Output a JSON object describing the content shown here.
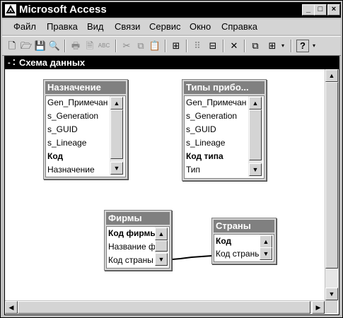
{
  "app": {
    "title": "Microsoft Access"
  },
  "titlebar_buttons": [
    "_",
    "□",
    "×"
  ],
  "menu": [
    "Файл",
    "Правка",
    "Вид",
    "Связи",
    "Сервис",
    "Окно",
    "Справка"
  ],
  "toolbar_icons": {
    "new": "🗋",
    "open": "🗁",
    "save": "💾",
    "print_preview": "🔍",
    "print": "🖶",
    "preview": "🗎",
    "spell": "ABC",
    "cut": "✂",
    "copy": "⧉",
    "paste": "📋",
    "show_table": "⊞",
    "direct_rel": "⠿",
    "all_rel": "⊟",
    "delete": "✕",
    "db_window": "⧉",
    "new_object": "⊞",
    "help": "?"
  },
  "document": {
    "title": "Схема данных",
    "icon": "- ⁚"
  },
  "tables": [
    {
      "title": "Назначение",
      "fields": [
        {
          "name": "Gen_Примечан",
          "key": false
        },
        {
          "name": "s_Generation",
          "key": false
        },
        {
          "name": "s_GUID",
          "key": false
        },
        {
          "name": "s_Lineage",
          "key": false
        },
        {
          "name": "Код",
          "key": true
        },
        {
          "name": "Назначение",
          "key": false
        }
      ]
    },
    {
      "title": "Типы прибо...",
      "fields": [
        {
          "name": "Gen_Примечан",
          "key": false
        },
        {
          "name": "s_Generation",
          "key": false
        },
        {
          "name": "s_GUID",
          "key": false
        },
        {
          "name": "s_Lineage",
          "key": false
        },
        {
          "name": "Код типа",
          "key": true
        },
        {
          "name": "Тип",
          "key": false
        }
      ]
    },
    {
      "title": "Фирмы",
      "fields": [
        {
          "name": "Код фирмы",
          "key": true
        },
        {
          "name": "Название ф",
          "key": false
        },
        {
          "name": "Код страны",
          "key": false
        }
      ]
    },
    {
      "title": "Страны",
      "fields": [
        {
          "name": "Код",
          "key": true
        },
        {
          "name": "Код страны",
          "key": false
        }
      ]
    }
  ],
  "scroll_arrows": {
    "up": "▲",
    "down": "▼",
    "left": "◀",
    "right": "▶"
  }
}
